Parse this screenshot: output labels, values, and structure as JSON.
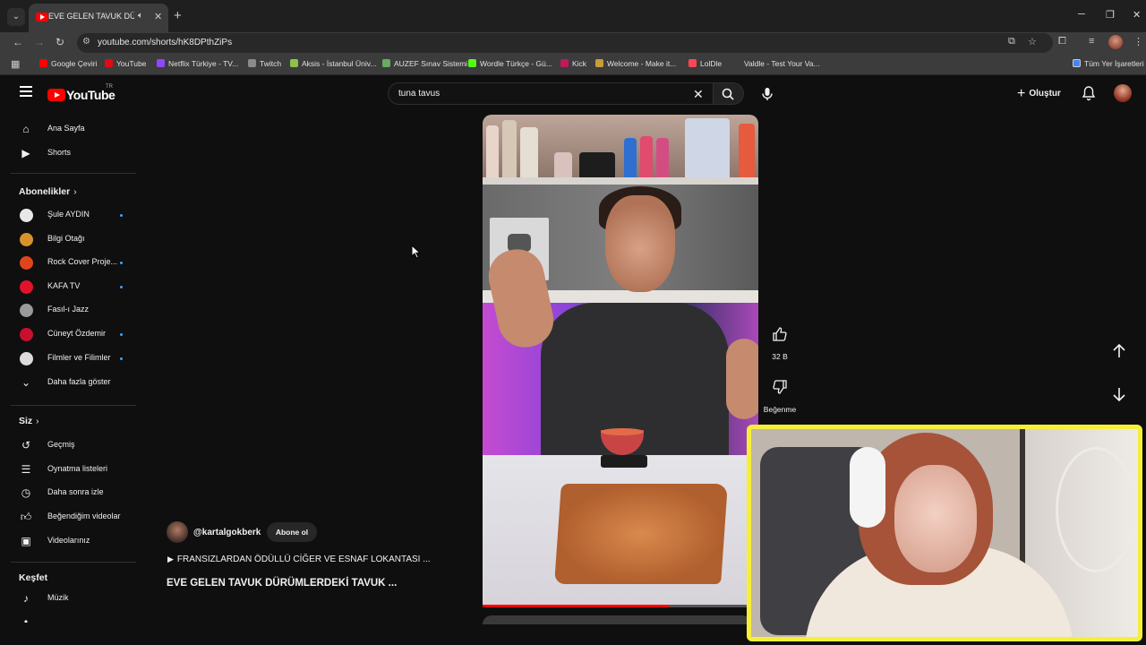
{
  "browser": {
    "tab_title": "EVE GELEN TAVUK DÜRÜMLERDEKİ TAVUK ...",
    "url": "youtube.com/shorts/hK8DPthZiPs",
    "bookmarks": [
      {
        "label": "Google Çeviri",
        "color": "#4285f4"
      },
      {
        "label": "YouTube",
        "color": "#ff0000"
      },
      {
        "label": "Netflix Türkiye - TV...",
        "color": "#e50914"
      },
      {
        "label": "Twitch",
        "color": "#9146ff"
      },
      {
        "label": "Aksis - İstanbul Üniv...",
        "color": "#8a8a8a"
      },
      {
        "label": "AUZEF Sınav Sistemi",
        "color": "#8bc34a"
      },
      {
        "label": "Wordle Türkçe - Gü...",
        "color": "#6aaa64"
      },
      {
        "label": "Kick",
        "color": "#53fc18"
      },
      {
        "label": "Welcome - Make it...",
        "color": "#c2185b"
      },
      {
        "label": "LolDle",
        "color": "#c89b3c"
      },
      {
        "label": "Valdle - Test Your Va...",
        "color": "#ff4655"
      }
    ],
    "all_bookmarks": "Tüm Yer İşaretleri"
  },
  "header": {
    "logo": "YouTube",
    "country": "TR",
    "search_query": "tuna tavus",
    "create_label": "Oluştur"
  },
  "sidebar": {
    "main": [
      {
        "label": "Ana Sayfa",
        "icon": "home-icon"
      },
      {
        "label": "Shorts",
        "icon": "shorts-icon"
      }
    ],
    "subscriptions_title": "Abonelikler",
    "subscriptions": [
      {
        "label": "Şule AYDIN",
        "color": "#e8e8e8",
        "new": true
      },
      {
        "label": "Bilgi Otağı",
        "color": "#d9922b",
        "new": false
      },
      {
        "label": "Rock Cover Proje...",
        "color": "#e0441a",
        "new": true
      },
      {
        "label": "KAFA TV",
        "color": "#e3122b",
        "new": true
      },
      {
        "label": "Fasıl-ı Jazz",
        "color": "#9a9a9a",
        "new": false
      },
      {
        "label": "Cüneyt Özdemir",
        "color": "#c8102e",
        "new": true
      },
      {
        "label": "Filmler ve Filimler",
        "color": "#dcdcdc",
        "new": true
      }
    ],
    "show_more": "Daha fazla göster",
    "you_title": "Siz",
    "you": [
      {
        "label": "Geçmiş",
        "icon": "history-icon"
      },
      {
        "label": "Oynatma listeleri",
        "icon": "playlist-icon"
      },
      {
        "label": "Daha sonra izle",
        "icon": "clock-icon"
      },
      {
        "label": "Beğendiğim videolar",
        "icon": "thumb-up-icon"
      },
      {
        "label": "Videolarınız",
        "icon": "your-videos-icon"
      }
    ],
    "explore_title": "Keşfet",
    "explore": [
      {
        "label": "Müzik",
        "icon": "music-icon"
      }
    ]
  },
  "short": {
    "channel_handle": "@kartalgokberk",
    "subscribe_label": "Abone ol",
    "music_line": "FRANSIZLARDAN ÖDÜLLÜ CİĞER VE ESNAF LOKANTASI ...",
    "title": "EVE GELEN TAVUK DÜRÜMLERDEKİ TAVUK ...",
    "likes": "32 B",
    "dislike_label": "Beğenme",
    "progress": 0.7
  }
}
